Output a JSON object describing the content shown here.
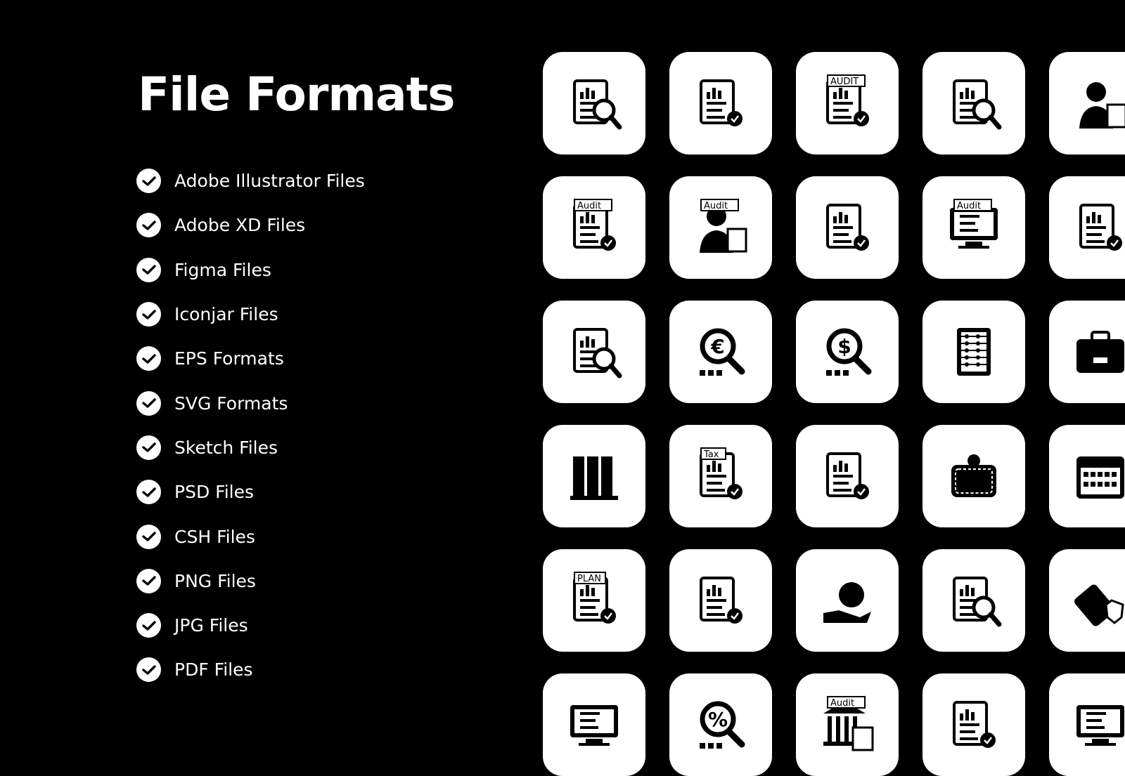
{
  "title": "File Formats",
  "formats": [
    "Adobe Illustrator Files",
    "Adobe XD Files",
    "Figma Files",
    "Iconjar Files",
    "EPS Formats",
    "SVG Formats",
    "Sketch Files",
    "PSD Files",
    "CSH Files",
    "PNG Files",
    "JPG Files",
    "PDF Files"
  ],
  "colors": {
    "background": "#000000",
    "tile": "#ffffff",
    "icon": "#000000"
  },
  "icons": [
    [
      {
        "name": "report-analysis-icon"
      },
      {
        "name": "document-approved-icon"
      },
      {
        "name": "audit-checklist-icon",
        "text": "AUDIT"
      },
      {
        "name": "data-analysis-settings-icon"
      },
      {
        "name": "female-auditor-icon"
      }
    ],
    [
      {
        "name": "audit-clipboard-time-icon",
        "text": "Audit"
      },
      {
        "name": "auditor-icon",
        "text": "Audit"
      },
      {
        "name": "financial-report-icon"
      },
      {
        "name": "online-audit-laptop-icon",
        "text": "Audit"
      },
      {
        "name": "budget-report-icon"
      }
    ],
    [
      {
        "name": "secure-document-search-icon"
      },
      {
        "name": "euro-search-icon"
      },
      {
        "name": "dollar-search-icon"
      },
      {
        "name": "abacus-icon"
      },
      {
        "name": "briefcase-icon"
      }
    ],
    [
      {
        "name": "binders-icon"
      },
      {
        "name": "tax-report-icon",
        "text": "Tax"
      },
      {
        "name": "documents-edit-icon"
      },
      {
        "name": "wallet-icon"
      },
      {
        "name": "calendar-icon"
      }
    ],
    [
      {
        "name": "plan-document-icon",
        "text": "PLAN"
      },
      {
        "name": "profile-document-icon"
      },
      {
        "name": "money-bag-hand-icon"
      },
      {
        "name": "credit-card-search-icon"
      },
      {
        "name": "usb-security-icon"
      }
    ],
    [
      {
        "name": "monitor-invoice-icon"
      },
      {
        "name": "percent-search-icon"
      },
      {
        "name": "bank-audit-icon",
        "text": "Audit"
      },
      {
        "name": "contract-scroll-icon"
      },
      {
        "name": "online-checklist-icon"
      }
    ]
  ]
}
